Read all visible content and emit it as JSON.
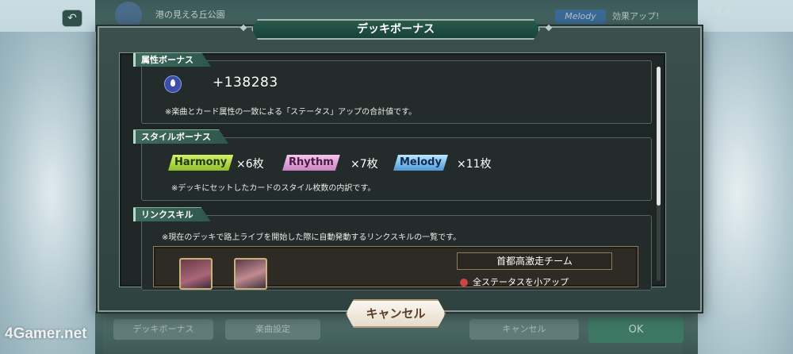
{
  "background": {
    "stage_name": "港の見える丘公園",
    "melody_tag": "Melody",
    "melody_text": "効果アップ!",
    "bottom_buttons": [
      "デッキボーナス",
      "楽曲設定",
      "",
      "キャンセル"
    ],
    "ok_label": "OK",
    "right_icons": "◀ ◆"
  },
  "dialog": {
    "title": "デッキボーナス",
    "attribute": {
      "label": "属性ボーナス",
      "icon": "water-drop-icon",
      "value": "+138283",
      "note": "※楽曲とカード属性の一致による「ステータス」アップの合計値です。"
    },
    "style": {
      "label": "スタイルボーナス",
      "items": [
        {
          "name": "Harmony",
          "count": "×6枚",
          "color": "#9ccc3a"
        },
        {
          "name": "Rhythm",
          "count": "×7枚",
          "color": "#d98bd0"
        },
        {
          "name": "Melody",
          "count": "×11枚",
          "color": "#56a7e0"
        }
      ],
      "note": "※デッキにセットしたカードのスタイル枚数の内訳です。"
    },
    "link": {
      "label": "リンクスキル",
      "note": "※現在のデッキで路上ライブを開始した際に自動発動するリンクスキルの一覧です。",
      "team_name": "首都高激走チーム",
      "skill_text": "全ステータスを小アップ"
    },
    "cancel_label": "キャンセル"
  },
  "watermark": "4Gamer.net"
}
